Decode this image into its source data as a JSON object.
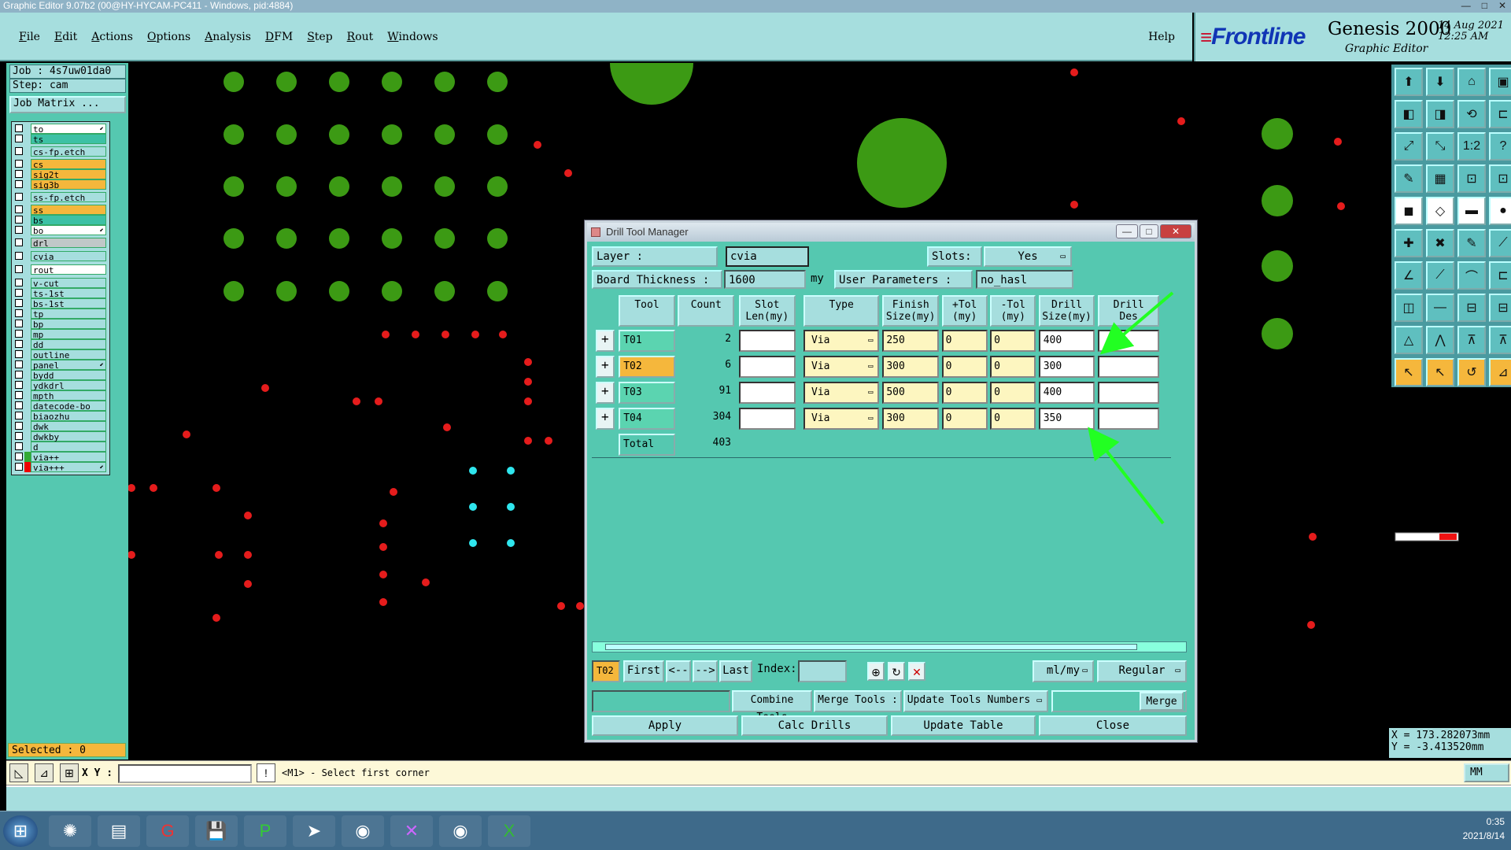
{
  "os": {
    "title": "Graphic Editor 9.07b2 (00@HY-HYCAM-PC411 - Windows, pid:4884)",
    "win_btns": [
      "—",
      "□",
      "✕"
    ]
  },
  "menu": {
    "items": [
      "File",
      "Edit",
      "Actions",
      "Options",
      "Analysis",
      "DFM",
      "Step",
      "Rout",
      "Windows"
    ],
    "help": "Help"
  },
  "brand": {
    "logo": "Frontline",
    "product": "Genesis 2000",
    "subtitle": "Graphic Editor",
    "date": "14 Aug 2021",
    "time": "12:25 AM"
  },
  "left": {
    "job": "Job : 4s7uw01da0",
    "step": "Step: cam",
    "matrix": "Job Matrix ...",
    "layers": [
      {
        "name": "to",
        "bg": "white",
        "mark": true
      },
      {
        "name": "ts",
        "bg": "teal"
      },
      {
        "name": "cs-fp.etch",
        "bg": "lt"
      },
      {
        "name": "cs",
        "bg": "orange"
      },
      {
        "name": "sig2t",
        "bg": "orange"
      },
      {
        "name": "sig3b",
        "bg": "orange"
      },
      {
        "name": "ss-fp.etch",
        "bg": "lt"
      },
      {
        "name": "ss",
        "bg": "orange"
      },
      {
        "name": "bs",
        "bg": "teal"
      },
      {
        "name": "bo",
        "bg": "white",
        "mark": true
      },
      {
        "name": "drl",
        "bg": "grey"
      },
      {
        "name": "cvia",
        "bg": "lt"
      },
      {
        "name": "rout",
        "bg": "white"
      },
      {
        "name": "v-cut",
        "bg": "lt"
      },
      {
        "name": "ts-1st",
        "bg": "lt"
      },
      {
        "name": "bs-1st",
        "bg": "lt"
      },
      {
        "name": "tp",
        "bg": "lt"
      },
      {
        "name": "bp",
        "bg": "lt"
      },
      {
        "name": "mp",
        "bg": "lt"
      },
      {
        "name": "dd",
        "bg": "lt"
      },
      {
        "name": "outline",
        "bg": "lt"
      },
      {
        "name": "panel",
        "bg": "lt",
        "mark": true
      },
      {
        "name": "bydd",
        "bg": "lt"
      },
      {
        "name": "ydkdrl",
        "bg": "lt"
      },
      {
        "name": "mpth",
        "bg": "lt"
      },
      {
        "name": "datecode-bo",
        "bg": "lt"
      },
      {
        "name": "biaozhu",
        "bg": "lt"
      },
      {
        "name": "dwk",
        "bg": "lt"
      },
      {
        "name": "dwkby",
        "bg": "lt"
      },
      {
        "name": "d",
        "bg": "lt"
      },
      {
        "name": "via++",
        "bg": "lt",
        "swatch": "#3a3"
      },
      {
        "name": "via+++",
        "bg": "lt",
        "swatch": "#e00",
        "mark": true
      }
    ],
    "selected": "Selected : 0"
  },
  "right": {
    "x": "X = 173.282073mm",
    "y": "Y = -3.413520mm"
  },
  "cmd": {
    "xy_label": "X Y :",
    "message": "<M1> - Select first corner",
    "unit": "MM"
  },
  "taskbar": {
    "time": "0:35",
    "date": "2021/8/14"
  },
  "dialog": {
    "title": "Drill Tool Manager",
    "layer_label": "Layer :",
    "layer_value": "cvia",
    "slots_label": "Slots:",
    "slots_value": "Yes",
    "thickness_label": "Board Thickness :",
    "thickness_value": "1600",
    "thickness_unit": "my",
    "user_params_label": "User Parameters :",
    "user_params_value": "no_hasl",
    "headers": [
      "Tool",
      "Count",
      "Slot\nLen(my)",
      "Type",
      "Finish\nSize(my)",
      "+Tol\n(my)",
      "-Tol\n(my)",
      "Drill\nSize(my)",
      "Drill\nDes"
    ],
    "rows": [
      {
        "tool": "T01",
        "count": "2",
        "type": "Via",
        "finish": "250",
        "ptol": "0",
        "mtol": "0",
        "drill": "400"
      },
      {
        "tool": "T02",
        "count": "6",
        "type": "Via",
        "finish": "300",
        "ptol": "0",
        "mtol": "0",
        "drill": "300"
      },
      {
        "tool": "T03",
        "count": "91",
        "type": "Via",
        "finish": "500",
        "ptol": "0",
        "mtol": "0",
        "drill": "400"
      },
      {
        "tool": "T04",
        "count": "304",
        "type": "Via",
        "finish": "300",
        "ptol": "0",
        "mtol": "0",
        "drill": "350"
      }
    ],
    "total_label": "Total",
    "total_count": "403",
    "nav": {
      "current": "T02",
      "first": "First",
      "prev": "<--",
      "next": "-->",
      "last": "Last",
      "index": "Index:",
      "units": "ml/my",
      "mode": "Regular"
    },
    "actions1": {
      "combine": "Combine Tools",
      "merge_tools": "Merge Tools :",
      "update_numbers": "Update Tools Numbers",
      "merge": "Merge"
    },
    "actions2": {
      "apply": "Apply",
      "calc": "Calc Drills",
      "update_table": "Update Table",
      "close": "Close"
    }
  }
}
